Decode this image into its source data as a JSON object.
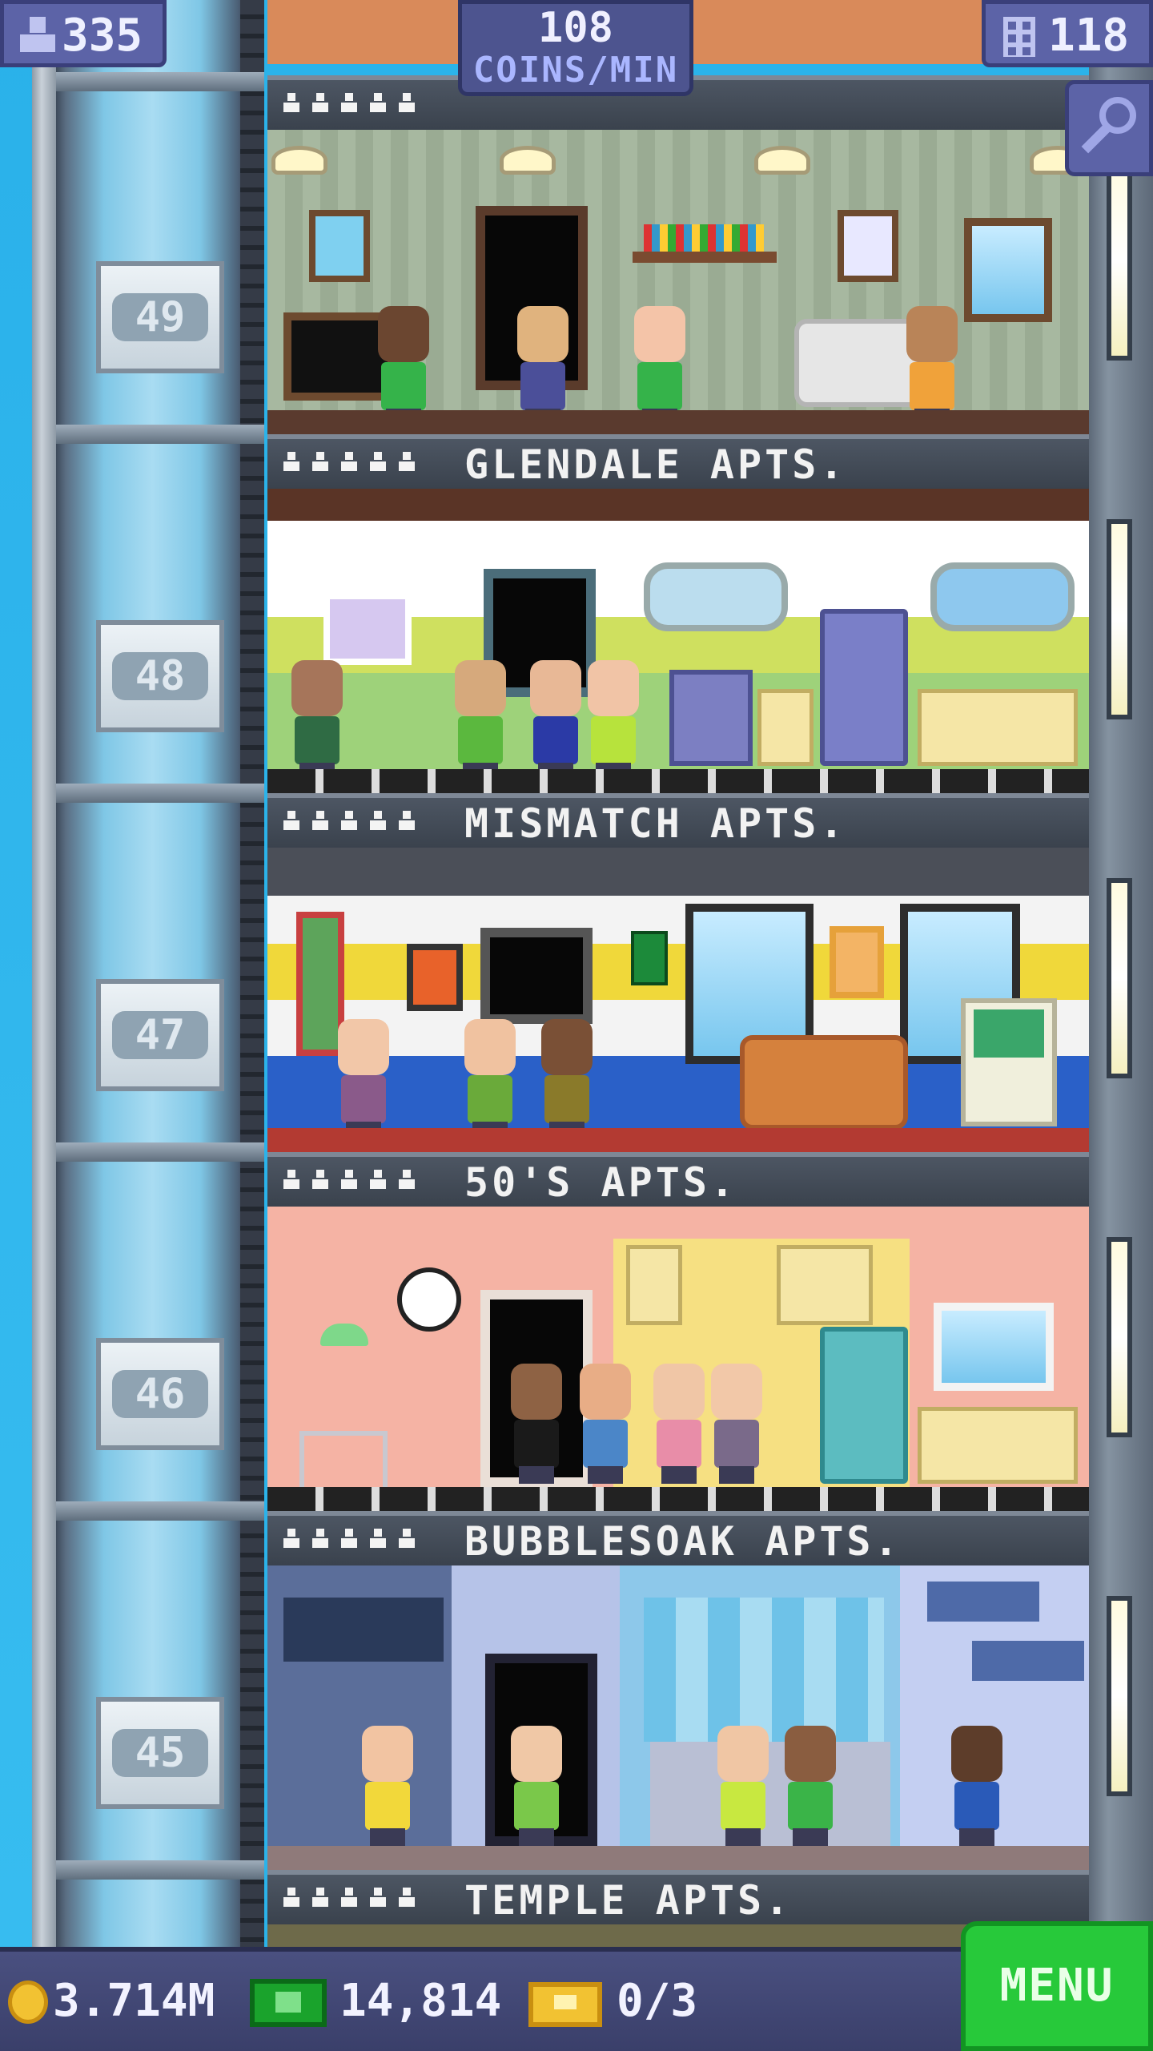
{
  "hud": {
    "population": "335",
    "coins_per_min_value": "108",
    "coins_per_min_unit": "COINS/MIN",
    "floors": "118"
  },
  "floors": [
    {
      "number": "49",
      "name": "GLENDALE APTS."
    },
    {
      "number": "48",
      "name": "MISMATCH APTS."
    },
    {
      "number": "47",
      "name": "50'S APTS."
    },
    {
      "number": "46",
      "name": "BUBBLESOAK APTS."
    },
    {
      "number": "45",
      "name": "TEMPLE APTS."
    }
  ],
  "bottom": {
    "coins": "3.714M",
    "bux": "14,814",
    "tickets": "0/3",
    "menu_label": "MENU"
  }
}
